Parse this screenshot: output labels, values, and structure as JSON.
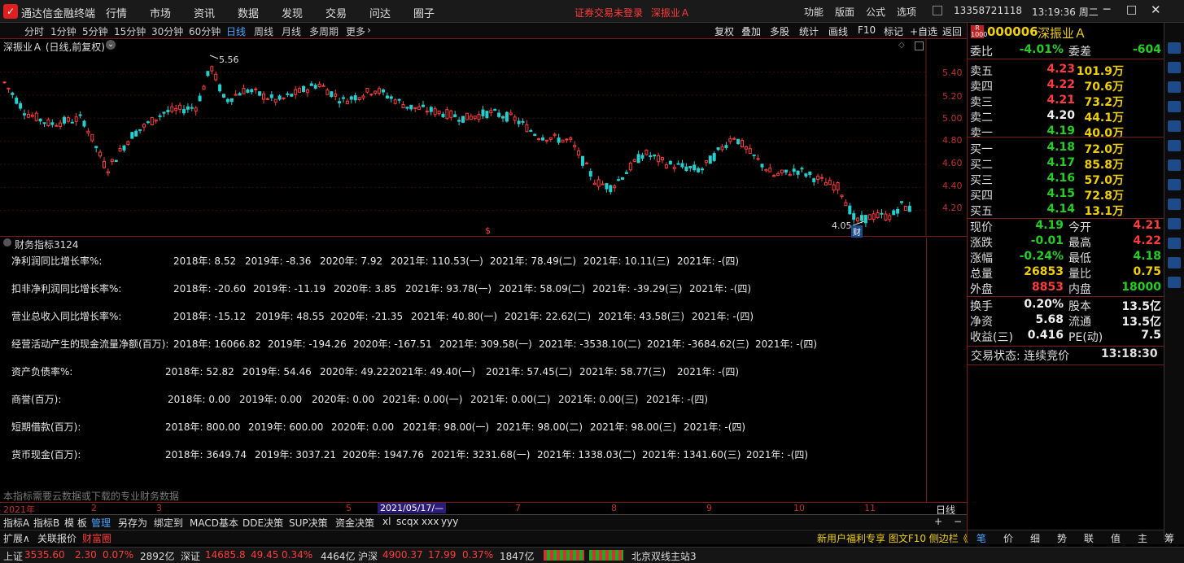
{
  "app": {
    "title": "通达信金融终端",
    "login_status": "证券交易未登录",
    "stock_link": "深振业Ａ",
    "menu": [
      "行情",
      "市场",
      "资讯",
      "数据",
      "发现",
      "交易",
      "问达",
      "圈子"
    ],
    "right_menu": [
      "功能",
      "版面",
      "公式",
      "选项"
    ],
    "phone": "13358721118",
    "time": "13:19:36 周二"
  },
  "periods": [
    "分时",
    "1分钟",
    "5分钟",
    "15分钟",
    "30分钟",
    "60分钟",
    "日线",
    "周线",
    "月线",
    "多周期",
    "更多"
  ],
  "tools": [
    "复权",
    "叠加",
    "多股",
    "统计",
    "画线",
    "F10",
    "标记",
    "+自选",
    "返回"
  ],
  "chart": {
    "title": "深振业Ａ (日线,前复权)",
    "high_label": "5.56",
    "low_label": "4.05",
    "low_tag": "财",
    "yaxis": [
      "5.40",
      "5.20",
      "5.00",
      "4.80",
      "4.60",
      "4.40",
      "4.20"
    ],
    "ymin": 4.05,
    "ymax": 5.56
  },
  "indicator": {
    "title": "财务指标3124",
    "note": "本指标需要云数据或下载的专业财务数据",
    "rows": [
      {
        "label": "净利润同比增长率%:",
        "vals": [
          "2018年: 8.52",
          "2019年: -8.36",
          "2020年: 7.92",
          "2021年: 110.53(一)",
          "2021年: 78.49(二)",
          "2021年: 10.11(三)",
          "2021年: -(四)"
        ]
      },
      {
        "label": "扣非净利润同比增长率%:",
        "vals": [
          "2018年: -20.60",
          "2019年: -11.19",
          "2020年: 3.85",
          "2021年: 93.78(一)",
          "2021年: 58.09(二)",
          "2021年: -39.29(三)",
          "2021年: -(四)"
        ]
      },
      {
        "label": "营业总收入同比增长率%:",
        "vals": [
          "2018年: -15.12",
          "2019年: 48.55",
          "2020年: -21.35",
          "2021年: 40.80(一)",
          "2021年: 22.62(二)",
          "2021年: 43.58(三)",
          "2021年: -(四)"
        ]
      },
      {
        "label": "经营活动产生的现金流量净额(百万):",
        "vals": [
          "2018年: 16066.82",
          "2019年: -194.26",
          "2020年: -167.51",
          "2021年: 309.58(一)",
          "2021年: -3538.10(二)",
          "2021年: -3684.62(三)",
          "2021年: -(四)"
        ]
      },
      {
        "label": "资产负债率%:",
        "vals": [
          "2018年: 52.82",
          "2019年: 54.46",
          "2020年: 49.22",
          "2021年: 49.40(一)",
          "2021年: 57.45(二)",
          "2021年: 58.77(三)",
          "2021年: -(四)"
        ]
      },
      {
        "label": "商誉(百万):",
        "vals": [
          "2018年: 0.00",
          "2019年: 0.00",
          "2020年: 0.00",
          "2021年: 0.00(一)",
          "2021年: 0.00(二)",
          "2021年: 0.00(三)",
          "2021年: -(四)"
        ]
      },
      {
        "label": "短期借款(百万):",
        "vals": [
          "2018年: 800.00",
          "2019年: 600.00",
          "2020年: 0.00",
          "2021年: 98.00(一)",
          "2021年: 98.00(二)",
          "2021年: 98.00(三)",
          "2021年: -(四)"
        ]
      },
      {
        "label": "货币现金(百万):",
        "vals": [
          "2018年: 3649.74",
          "2019年: 3037.21",
          "2020年: 1947.76",
          "2021年: 3231.68(一)",
          "2021年: 1338.03(二)",
          "2021年: 1341.60(三)",
          "2021年: -(四)"
        ]
      }
    ]
  },
  "dates": {
    "year": "2021年",
    "months": [
      "2",
      "3",
      "5",
      "7",
      "8",
      "9",
      "10",
      "11"
    ],
    "cursor": "2021/05/17/—",
    "period": "日线"
  },
  "quote": {
    "code": "000006",
    "name": "深振业Ａ",
    "wb_label": "委比",
    "wb": "-4.01%",
    "wc_label": "委差",
    "wc": "-604",
    "asks": [
      {
        "l": "卖五",
        "p": "4.23",
        "v": "101.9万"
      },
      {
        "l": "卖四",
        "p": "4.22",
        "v": "70.6万"
      },
      {
        "l": "卖三",
        "p": "4.21",
        "v": "73.2万"
      },
      {
        "l": "卖二",
        "p": "4.20",
        "v": "44.1万"
      },
      {
        "l": "卖一",
        "p": "4.19",
        "v": "40.0万"
      }
    ],
    "bids": [
      {
        "l": "买一",
        "p": "4.18",
        "v": "72.0万"
      },
      {
        "l": "买二",
        "p": "4.17",
        "v": "85.8万"
      },
      {
        "l": "买三",
        "p": "4.16",
        "v": "57.0万"
      },
      {
        "l": "买四",
        "p": "4.15",
        "v": "72.8万"
      },
      {
        "l": "买五",
        "p": "4.14",
        "v": "13.1万"
      }
    ],
    "stats": [
      [
        "现价",
        "4.19",
        "今开",
        "4.21"
      ],
      [
        "涨跌",
        "-0.01",
        "最高",
        "4.22"
      ],
      [
        "涨幅",
        "-0.24%",
        "最低",
        "4.18"
      ],
      [
        "总量",
        "26853",
        "量比",
        "0.75"
      ],
      [
        "外盘",
        "8853",
        "内盘",
        "18000"
      ]
    ],
    "stats2": [
      [
        "换手",
        "0.20%",
        "股本",
        "13.5亿"
      ],
      [
        "净资",
        "5.68",
        "流通",
        "13.5亿"
      ],
      [
        "收益(三)",
        "0.416",
        "PE(动)",
        "7.5"
      ]
    ],
    "trade_status": "交易状态: 连续竞价",
    "trade_time": "13:18:30"
  },
  "tabs1": [
    "指标A",
    "指标B",
    "模 板",
    "管理",
    "另存为",
    "绑定到",
    "MACD基本",
    "DDE决策",
    "SUP决策",
    "资金决策",
    "xl",
    "scqx",
    "xxx",
    "yyy"
  ],
  "tabs2": [
    "扩展∧",
    "关联报价",
    "财富圈"
  ],
  "promo": "新用户福利专享 图文F10 侧边栏《",
  "rtabs": [
    "笔",
    "价",
    "细",
    "势",
    "联",
    "值",
    "主",
    "筹"
  ],
  "status": {
    "sh_label": "上证",
    "sh": "3535.60",
    "sh_chg": "2.30",
    "sh_pct": "0.07%",
    "sh_amt": "2892亿",
    "sz_label": "深证",
    "sz": "14685.8",
    "sz_chg": "49.45",
    "sz_pct": "0.34%",
    "sz_amt": "4464亿",
    "hs_label": "沪深",
    "hs": "4900.37",
    "hs_chg": "17.99",
    "hs_pct": "0.37%",
    "hs_amt": "1847亿",
    "server": "北京双线主站3"
  },
  "colors": {
    "up": "#ff3b3b",
    "down": "#22d022",
    "bg": "#000000",
    "grid": "#7a1a1a"
  }
}
